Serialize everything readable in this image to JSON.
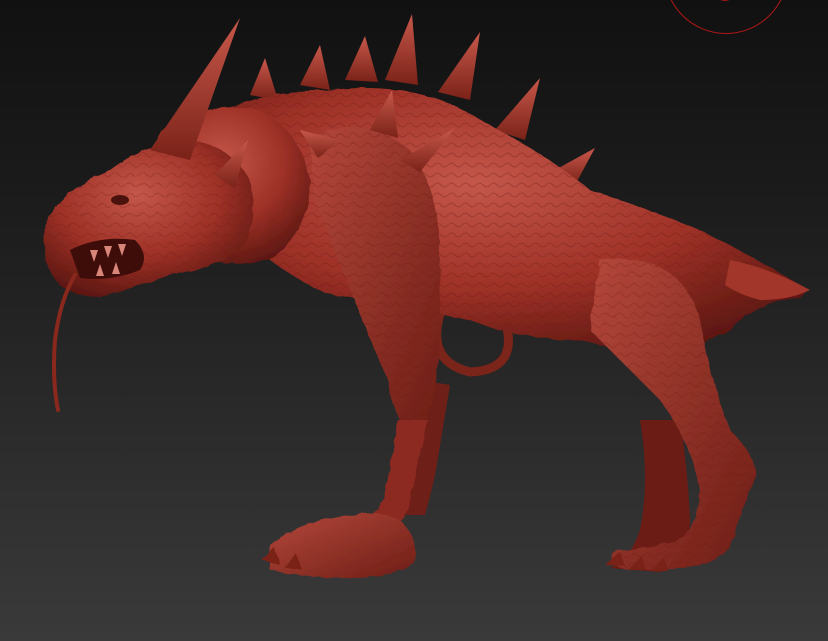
{
  "viewport": {
    "background_top": "#111111",
    "background_bottom": "#3a3a3a"
  },
  "model": {
    "material_color": "#9e3127",
    "highlight_color": "#c4574a",
    "shadow_color": "#5a1610",
    "object": "demon-hound-sculpt"
  },
  "gizmo": {
    "icon": "navigation-gizmo-icon",
    "color": "#b01818"
  }
}
